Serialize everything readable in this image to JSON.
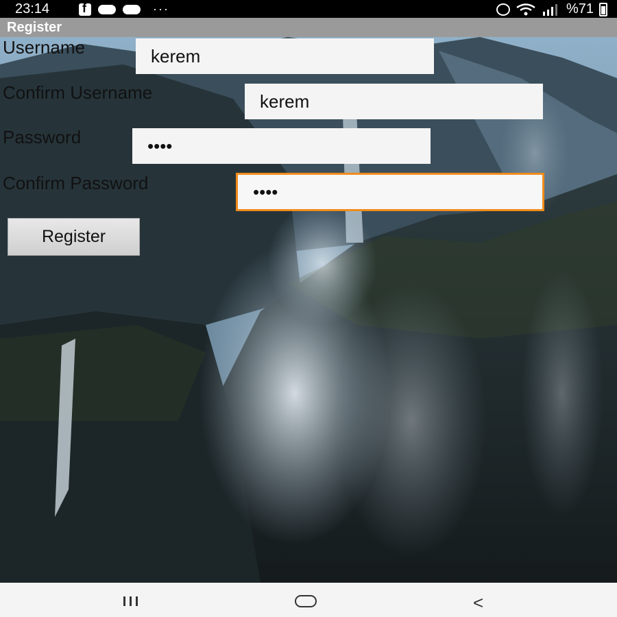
{
  "status_bar": {
    "time": "23:14",
    "notification_icons": [
      "facebook-icon",
      "cloud-icon",
      "cloud-icon"
    ],
    "more": "···",
    "battery_text": "%71",
    "right_icons": [
      "alarm-icon",
      "wifi-icon",
      "signal-icon",
      "battery-icon"
    ]
  },
  "title_bar": {
    "title": "Register"
  },
  "form": {
    "username": {
      "label": "Username",
      "value": "kerem"
    },
    "confirm_username": {
      "label": "Confirm Username",
      "value": "kerem"
    },
    "password": {
      "label": "Password",
      "value": "••••"
    },
    "confirm_password": {
      "label": "Confirm Password",
      "value": "••••"
    },
    "submit_label": "Register"
  },
  "nav_bar": {
    "icons": [
      "recents-icon",
      "home-icon",
      "back-icon"
    ]
  },
  "colors": {
    "focus_border": "#f08c1c",
    "title_bar": "#9a9a9a"
  }
}
